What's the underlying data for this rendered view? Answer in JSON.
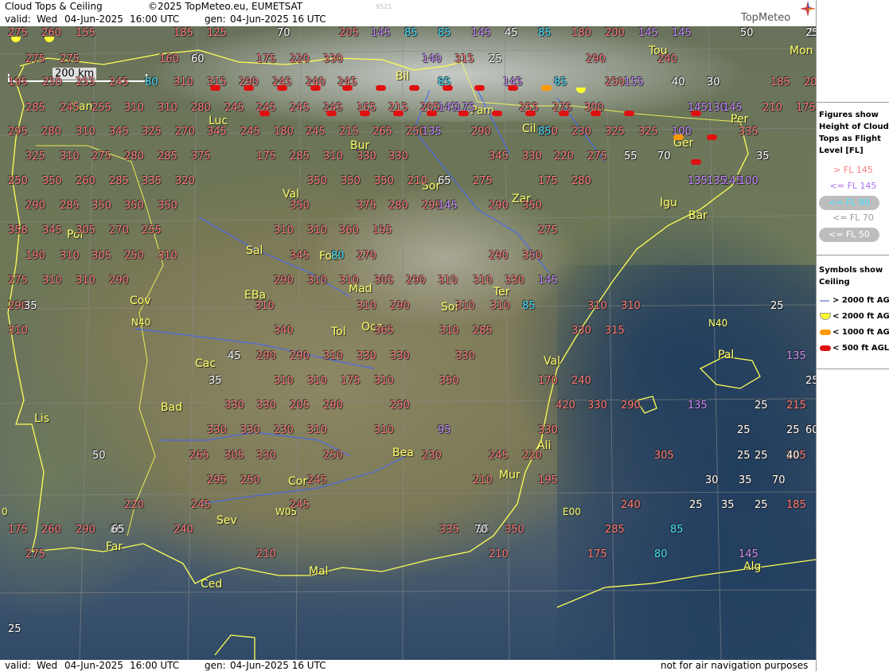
{
  "header": {
    "product_title": "Cloud Tops & Ceiling",
    "copyright": "©2025 TopMeteo.eu, EUMETSAT",
    "valid_label": "valid:",
    "valid_day": "Wed",
    "valid_date": "04-Jun-2025",
    "valid_time": "16:00 UTC",
    "gen_label": "gen:",
    "gen_value": "04-Jun-2025 16 UTC",
    "frame_number": "9521",
    "logo_text": "TopMeteo"
  },
  "map": {
    "scale_label": "200 km",
    "grid_labels": [
      "N40",
      "N40",
      "W05",
      "E00",
      "0"
    ],
    "cities": [
      "Tou",
      "Mon",
      "Bil",
      "San",
      "Pam",
      "Luc",
      "Cil",
      "Per",
      "Ger",
      "Bur",
      "Sor",
      "Val",
      "Zar",
      "Igu",
      "Bar",
      "Por",
      "Sal",
      "Foe",
      "Mad",
      "Cov",
      "EBa",
      "Soi",
      "Ter",
      "Tol",
      "Oca",
      "Cac",
      "Val",
      "Pal",
      "Lis",
      "Bad",
      "Ali",
      "Bea",
      "Cor",
      "Mur",
      "Sev",
      "Far",
      "Mal",
      "Ced",
      "Alg"
    ],
    "cloud_tops_red": [
      "275",
      "260",
      "155",
      "185",
      "125",
      "205",
      "180",
      "200",
      "275",
      "275",
      "160",
      "175",
      "220",
      "330",
      "315",
      "290",
      "240",
      "195",
      "250",
      "255",
      "245",
      "310",
      "315",
      "290",
      "245",
      "240",
      "245",
      "250",
      "185",
      "200",
      "285",
      "245",
      "255",
      "310",
      "310",
      "280",
      "245",
      "245",
      "245",
      "245",
      "165",
      "215",
      "205",
      "255",
      "275",
      "300",
      "210",
      "175",
      "295",
      "280",
      "310",
      "345",
      "325",
      "270",
      "345",
      "245",
      "180",
      "245",
      "215",
      "265",
      "250",
      "290",
      "230",
      "230",
      "325",
      "325",
      "335",
      "325",
      "310",
      "275",
      "280",
      "285",
      "375",
      "175",
      "285",
      "310",
      "330",
      "330",
      "345",
      "330",
      "220",
      "275",
      "250",
      "350",
      "260",
      "285",
      "335",
      "320",
      "350",
      "350",
      "350",
      "210",
      "275",
      "175",
      "280",
      "290",
      "285",
      "350",
      "350",
      "350",
      "350",
      "375",
      "280",
      "295",
      "290",
      "350",
      "358",
      "345",
      "305",
      "270",
      "255",
      "310",
      "310",
      "360",
      "195",
      "275",
      "190",
      "310",
      "305",
      "250",
      "310",
      "345",
      "270",
      "290",
      "350",
      "275",
      "310",
      "310",
      "290",
      "290",
      "310",
      "310",
      "305",
      "290",
      "310",
      "310",
      "330",
      "290",
      "310",
      "310",
      "290",
      "310",
      "310",
      "310",
      "310",
      "310",
      "340",
      "365",
      "310",
      "285",
      "330",
      "315",
      "290",
      "290",
      "310",
      "330",
      "330",
      "330",
      "310",
      "310",
      "175",
      "310",
      "350",
      "170",
      "240",
      "330",
      "330",
      "205",
      "290",
      "250",
      "420",
      "330",
      "290",
      "215",
      "330",
      "330",
      "230",
      "310",
      "310",
      "330",
      "265",
      "305",
      "330",
      "250",
      "230",
      "245",
      "220",
      "305",
      "245",
      "295",
      "250",
      "245",
      "210",
      "195",
      "220",
      "245",
      "245",
      "240",
      "185",
      "175",
      "260",
      "290",
      "240",
      "335",
      "350",
      "285",
      "275",
      "210",
      "210",
      "175"
    ],
    "cloud_tops_purple": [
      "145",
      "145",
      "145",
      "145",
      "140",
      "155",
      "145",
      "145",
      "175",
      "145",
      "130",
      "145",
      "135",
      "100",
      "145",
      "135",
      "145",
      "135",
      "100",
      "145",
      "135",
      "135",
      "95",
      "145"
    ],
    "cloud_tops_cyan": [
      "85",
      "85",
      "85",
      "80",
      "85",
      "85",
      "85",
      "80",
      "85",
      "85",
      "80"
    ],
    "cloud_tops_white": [
      "70",
      "45",
      "50",
      "25",
      "60",
      "25",
      "40",
      "30",
      "55",
      "70",
      "35",
      "65",
      "35",
      "45",
      "35",
      "25",
      "50",
      "25",
      "25",
      "25",
      "25",
      "60",
      "25",
      "25",
      "30",
      "35",
      "70",
      "25",
      "35",
      "25",
      "60",
      "35",
      "25",
      "40",
      "65",
      "70",
      "25"
    ],
    "ceiling_symbols": {
      "red": 24,
      "orange": 2,
      "yellow": 3
    }
  },
  "footer": {
    "valid_label": "valid:",
    "valid_day": "Wed",
    "valid_date": "04-Jun-2025",
    "valid_time": "16:00 UTC",
    "gen_label": "gen:",
    "gen_value": "04-Jun-2025 16 UTC",
    "disclaimer": "not for air navigation purposes"
  },
  "legend": {
    "figures_title_lines": [
      "Figures show",
      "Height of Cloud",
      "Tops as Flight",
      "Level  [FL]"
    ],
    "levels": [
      {
        "label": "> FL 145",
        "color": "#ff7a7a",
        "pill": false
      },
      {
        "label": "<= FL 145",
        "color": "#c88cff",
        "pill": false
      },
      {
        "label": "<= FL 90",
        "color": "#40e0ff",
        "pill": true
      },
      {
        "label": "<= FL 70",
        "color": "#ffffff",
        "pill": false
      },
      {
        "label": "<= FL 50",
        "color": "#ffffff",
        "pill": true
      }
    ],
    "symbols_title_lines": [
      "Symbols show",
      "Ceiling"
    ],
    "symbols": [
      {
        "label": "> 2000 ft AGL",
        "icon": "line-icon"
      },
      {
        "label": "< 2000 ft AGL",
        "icon": "yellow-semicircle-icon"
      },
      {
        "label": "< 1000 ft AGL",
        "icon": "orange-pill-icon"
      },
      {
        "label": "< 500 ft AGL",
        "icon": "red-pill-icon"
      }
    ]
  }
}
